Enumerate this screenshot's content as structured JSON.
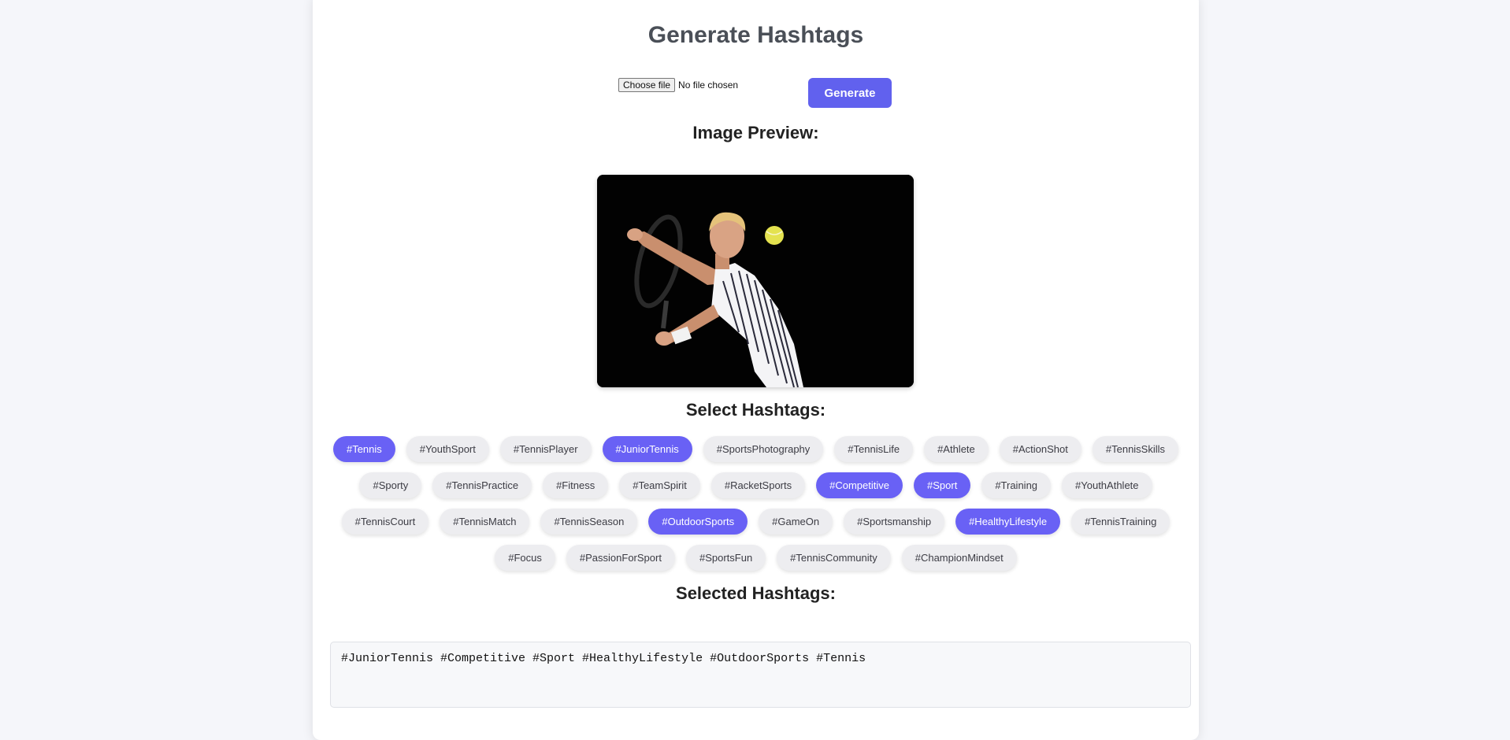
{
  "page": {
    "title": "Generate Hashtags"
  },
  "upload": {
    "choose_label": "Choose file",
    "status": "No file chosen",
    "generate_label": "Generate"
  },
  "preview": {
    "heading": "Image Preview:"
  },
  "hashtags": {
    "heading": "Select Hashtags:",
    "items": [
      {
        "label": "#Tennis",
        "selected": true
      },
      {
        "label": "#YouthSport",
        "selected": false
      },
      {
        "label": "#TennisPlayer",
        "selected": false
      },
      {
        "label": "#JuniorTennis",
        "selected": true
      },
      {
        "label": "#SportsPhotography",
        "selected": false
      },
      {
        "label": "#TennisLife",
        "selected": false
      },
      {
        "label": "#Athlete",
        "selected": false
      },
      {
        "label": "#ActionShot",
        "selected": false
      },
      {
        "label": "#TennisSkills",
        "selected": false
      },
      {
        "label": "#Sporty",
        "selected": false
      },
      {
        "label": "#TennisPractice",
        "selected": false
      },
      {
        "label": "#Fitness",
        "selected": false
      },
      {
        "label": "#TeamSpirit",
        "selected": false
      },
      {
        "label": "#RacketSports",
        "selected": false
      },
      {
        "label": "#Competitive",
        "selected": true
      },
      {
        "label": "#Sport",
        "selected": true
      },
      {
        "label": "#Training",
        "selected": false
      },
      {
        "label": "#YouthAthlete",
        "selected": false
      },
      {
        "label": "#TennisCourt",
        "selected": false
      },
      {
        "label": "#TennisMatch",
        "selected": false
      },
      {
        "label": "#TennisSeason",
        "selected": false
      },
      {
        "label": "#OutdoorSports",
        "selected": true
      },
      {
        "label": "#GameOn",
        "selected": false
      },
      {
        "label": "#Sportsmanship",
        "selected": false
      },
      {
        "label": "#HealthyLifestyle",
        "selected": true
      },
      {
        "label": "#TennisTraining",
        "selected": false
      },
      {
        "label": "#Focus",
        "selected": false
      },
      {
        "label": "#PassionForSport",
        "selected": false
      },
      {
        "label": "#SportsFun",
        "selected": false
      },
      {
        "label": "#TennisCommunity",
        "selected": false
      },
      {
        "label": "#ChampionMindset",
        "selected": false
      }
    ]
  },
  "selected": {
    "heading": "Selected Hashtags:",
    "value": "#JuniorTennis #Competitive #Sport #HealthyLifestyle #OutdoorSports #Tennis"
  },
  "colors": {
    "accent": "#6161ee",
    "tag_selected": "#6961f5",
    "tag_default": "#ededf0"
  }
}
